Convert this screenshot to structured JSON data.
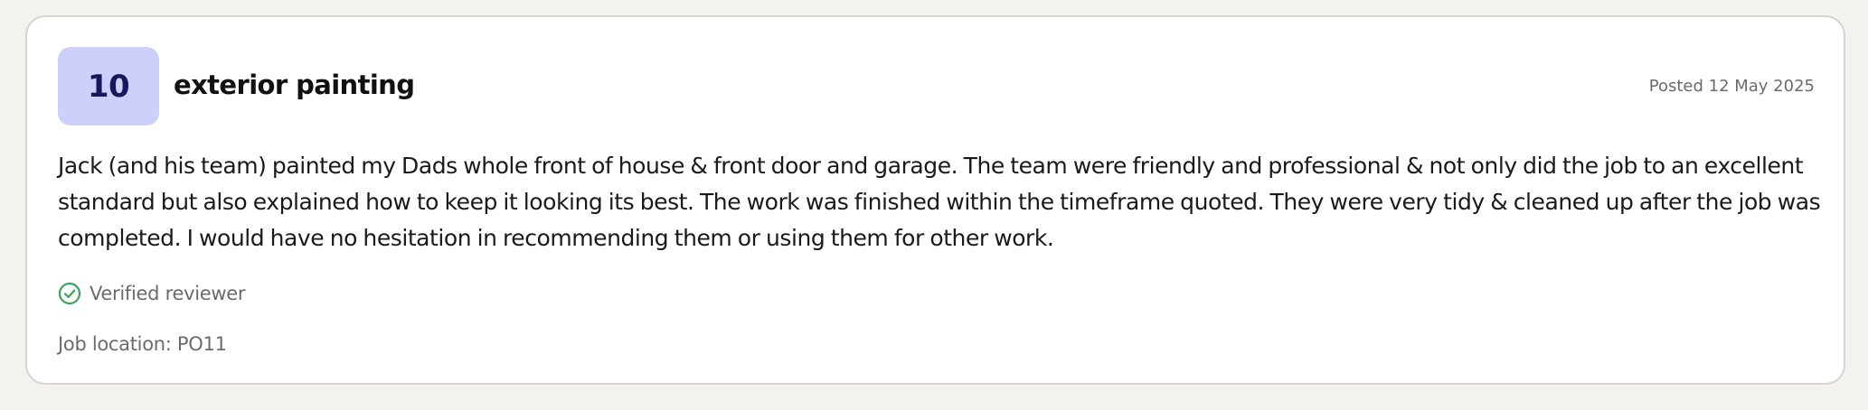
{
  "review": {
    "score": "10",
    "title": "exterior painting",
    "posted": "Posted 12 May 2025",
    "body": "Jack (and his team) painted my Dads whole front of house & front door and garage. The team were friendly and professional & not only did the job to an excellent standard but also explained how to keep it looking its best. The work was finished within the timeframe quoted. They were very tidy & cleaned up after the job was completed. I would have no hesitation in recommending them or using them for other work.",
    "verified_label": "Verified reviewer",
    "verified_icon": "check-circle-icon",
    "job_location": "Job location: PO11"
  },
  "colors": {
    "badge_background": "#ccd0fa",
    "badge_text": "#161a5c",
    "verified_green": "#3aa35c",
    "muted_text": "#6b6b6b",
    "card_border": "#d6d4cf",
    "page_background": "#f3f2ef"
  }
}
